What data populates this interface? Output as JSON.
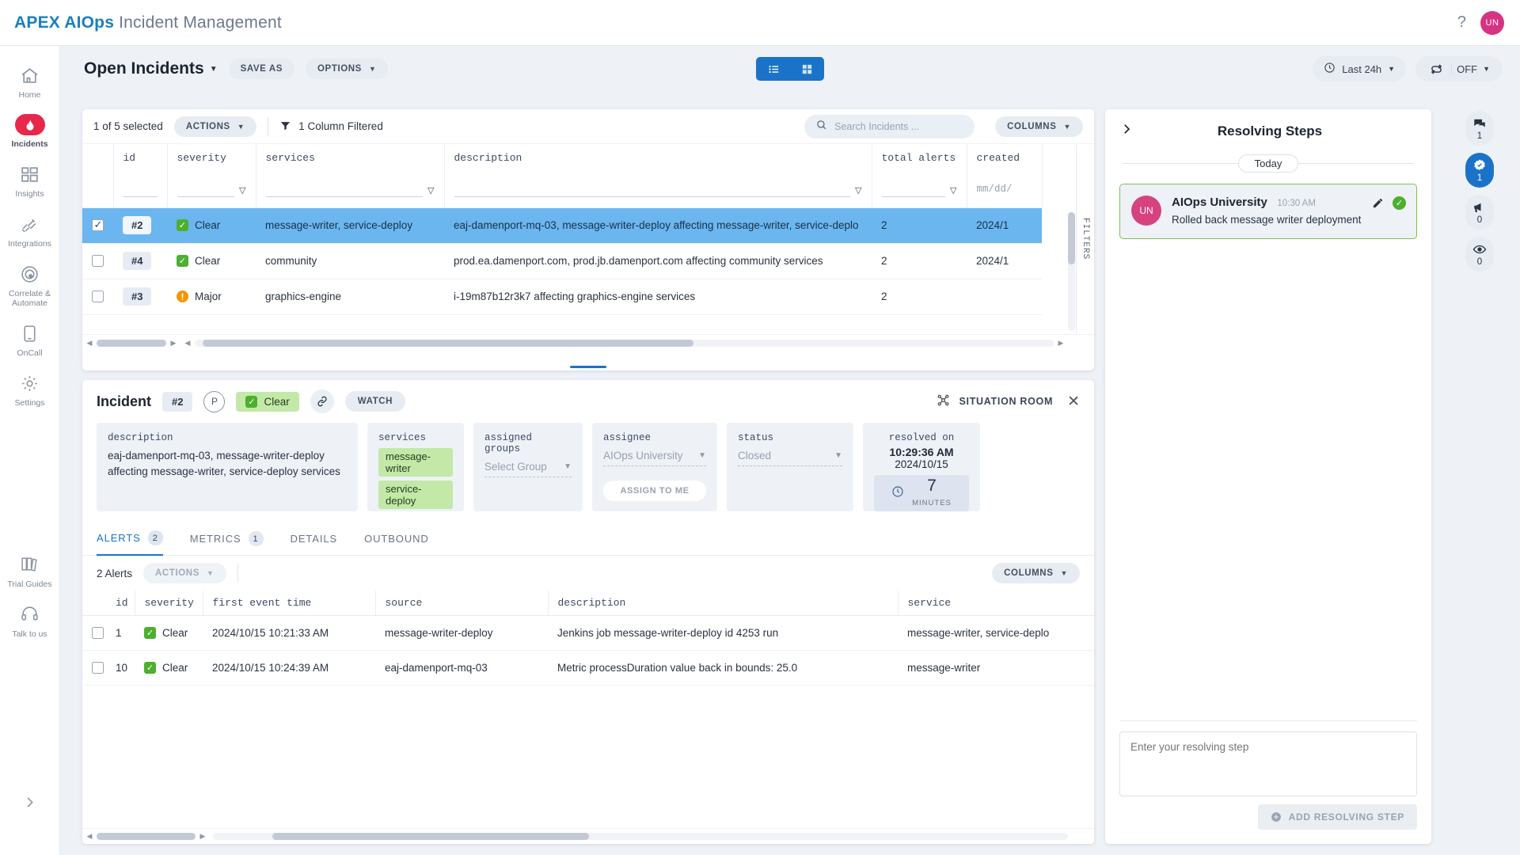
{
  "app": {
    "brand_primary": "APEX AIOps",
    "brand_secondary": "Incident Management",
    "help_icon": "question-icon",
    "avatar_initials": "UN",
    "accent_blue": "#1a73c8",
    "accent_red": "#e8274b",
    "severity_clear_color": "#4caf2f",
    "severity_major_color": "#f49400"
  },
  "rail": {
    "items": [
      {
        "label": "Home",
        "icon": "home-icon"
      },
      {
        "label": "Incidents",
        "icon": "fire-icon"
      },
      {
        "label": "Insights",
        "icon": "grid-icon"
      },
      {
        "label": "Integrations",
        "icon": "plug-icon"
      },
      {
        "label": "Correlate &\nAutomate",
        "icon": "target-icon"
      },
      {
        "label": "OnCall",
        "icon": "phone-icon"
      },
      {
        "label": "Settings",
        "icon": "gear-icon"
      }
    ],
    "bottom": [
      {
        "label": "Trial Guides",
        "icon": "books-icon"
      },
      {
        "label": "Talk to us",
        "icon": "headset-icon"
      }
    ],
    "expand_icon": "chevron-right-icon"
  },
  "header": {
    "view_title": "Open Incidents",
    "save_as": "SAVE AS",
    "options": "OPTIONS",
    "view_list_icon": "list-view-icon",
    "view_card_icon": "card-view-icon",
    "time_range": "Last 24h",
    "time_icon": "clock-icon",
    "refresh_icon": "refresh-icon",
    "refresh_state": "OFF"
  },
  "grid_toolbar": {
    "selected": "1 of 5 selected",
    "actions": "ACTIONS",
    "filter_icon": "funnel-icon",
    "filtered_note": "1 Column Filtered",
    "search_icon": "search-icon",
    "search_placeholder": "Search Incidents ...",
    "search_value": "",
    "columns": "COLUMNS"
  },
  "incidents_grid": {
    "filters_tab_label": "FILTERS",
    "columns": [
      "id",
      "severity",
      "services",
      "description",
      "total alerts",
      "created"
    ],
    "filter_placeholders": [
      "",
      "",
      "",
      "",
      "",
      "mm/dd/"
    ],
    "rows": [
      {
        "selected": true,
        "id": "#2",
        "severity": "Clear",
        "severity_kind": "clear",
        "services": "message-writer, service-deploy",
        "description": "eaj-damenport-mq-03, message-writer-deploy affecting message-writer, service-deplo",
        "total_alerts": "2",
        "created": "2024/1"
      },
      {
        "selected": false,
        "id": "#4",
        "severity": "Clear",
        "severity_kind": "clear",
        "services": "community",
        "description": "prod.ea.damenport.com, prod.jb.damenport.com affecting community services",
        "total_alerts": "2",
        "created": "2024/1"
      },
      {
        "selected": false,
        "id": "#3",
        "severity": "Major",
        "severity_kind": "major",
        "services": "graphics-engine",
        "description": "i-19m87b12r3k7 affecting graphics-engine services",
        "total_alerts": "2",
        "created": ""
      }
    ]
  },
  "detail": {
    "title": "Incident",
    "id": "#2",
    "priority": "P",
    "severity": "Clear",
    "link_icon": "link-icon",
    "watch": "WATCH",
    "situation_room": "SITUATION ROOM",
    "situation_icon": "situation-icon",
    "close_icon": "close-icon",
    "fields": {
      "description_label": "description",
      "description_value": "eaj-damenport-mq-03, message-writer-deploy affecting message-writer, service-deploy services",
      "services_label": "services",
      "services_tags": [
        "message-writer",
        "service-deploy"
      ],
      "assigned_groups_label": "assigned groups",
      "assigned_groups_value": "Select Group",
      "assignee_label": "assignee",
      "assignee_value": "AIOps University",
      "assign_to_me": "ASSIGN TO ME",
      "status_label": "status",
      "status_value": "Closed",
      "resolved_label": "resolved on",
      "resolved_time": "10:29:36 AM",
      "resolved_date": "2024/10/15",
      "duration_icon": "clock-icon",
      "duration_value": "7",
      "duration_unit": "MINUTES"
    },
    "tabs": [
      {
        "label": "ALERTS",
        "count": "2",
        "active": true
      },
      {
        "label": "METRICS",
        "count": "1",
        "active": false
      },
      {
        "label": "DETAILS",
        "count": "",
        "active": false
      },
      {
        "label": "OUTBOUND",
        "count": "",
        "active": false
      }
    ],
    "alerts_bar": {
      "count_label": "2 Alerts",
      "actions": "ACTIONS",
      "columns": "COLUMNS"
    },
    "alerts_table": {
      "columns": [
        "id",
        "severity",
        "first event time",
        "source",
        "description",
        "service"
      ],
      "rows": [
        {
          "id": "1",
          "severity": "Clear",
          "first_event_time": "2024/10/15 10:21:33 AM",
          "source": "message-writer-deploy",
          "description": "Jenkins job message-writer-deploy id 4253 run",
          "service": "message-writer, service-deplo"
        },
        {
          "id": "10",
          "severity": "Clear",
          "first_event_time": "2024/10/15 10:24:39 AM",
          "source": "eaj-damenport-mq-03",
          "description": "Metric processDuration value back in bounds: 25.0",
          "service": "message-writer"
        }
      ]
    }
  },
  "right_panel": {
    "expand_icon": "chevron-right-icon",
    "title": "Resolving Steps",
    "day_divider": "Today",
    "step": {
      "avatar_initials": "UN",
      "author": "AIOps University",
      "time": "10:30 AM",
      "text": "Rolled back message writer deployment",
      "edit_icon": "pencil-icon",
      "status_icon": "check-circle-icon"
    },
    "input_placeholder": "Enter your resolving step",
    "add_button": "ADD RESOLVING STEP",
    "add_icon": "plus-circle-icon"
  },
  "icon_rail": [
    {
      "icon": "comments-icon",
      "count": "1",
      "active": false
    },
    {
      "icon": "verified-check-icon",
      "count": "1",
      "active": true
    },
    {
      "icon": "megaphone-icon",
      "count": "0",
      "active": false
    },
    {
      "icon": "eye-icon",
      "count": "0",
      "active": false
    }
  ]
}
